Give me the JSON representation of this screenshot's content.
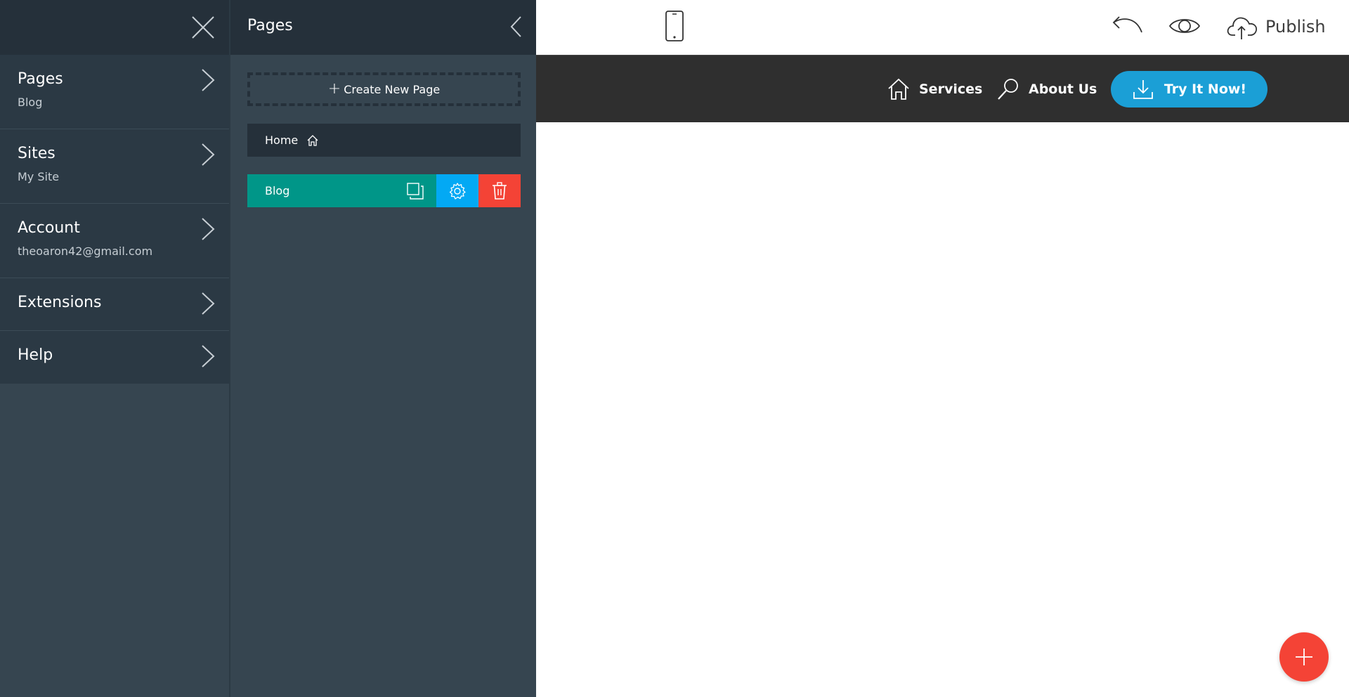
{
  "main_menu": {
    "close_icon": "close-icon",
    "items": [
      {
        "title": "Pages",
        "subtitle": "Blog"
      },
      {
        "title": "Sites",
        "subtitle": "My Site"
      },
      {
        "title": "Account",
        "subtitle": "theoaron42@gmail.com"
      },
      {
        "title": "Extensions",
        "subtitle": ""
      },
      {
        "title": "Help",
        "subtitle": ""
      }
    ]
  },
  "pages_panel": {
    "title": "Pages",
    "create_label": "Create New Page",
    "pages": [
      {
        "name": "Home",
        "is_home": true
      },
      {
        "name": "Blog",
        "selected": true
      }
    ]
  },
  "toolbar": {
    "publish_label": "Publish",
    "icons": [
      "mobile-device-icon",
      "undo-icon",
      "preview-eye-icon",
      "cloud-upload-icon"
    ]
  },
  "site_nav": {
    "links": [
      {
        "label": "Services",
        "icon": "home-icon"
      },
      {
        "label": "About Us",
        "icon": "search-icon"
      }
    ],
    "cta_label": "Try It Now!",
    "cta_icon": "download-icon"
  },
  "colors": {
    "sidebar_bg": "#364550",
    "sidebar_header": "#25303a",
    "page_selected": "#009688",
    "settings": "#03a9f4",
    "delete": "#f44336",
    "nav_bg": "#2f2f2f",
    "cta": "#1b9fd6",
    "fab": "#f44336"
  }
}
